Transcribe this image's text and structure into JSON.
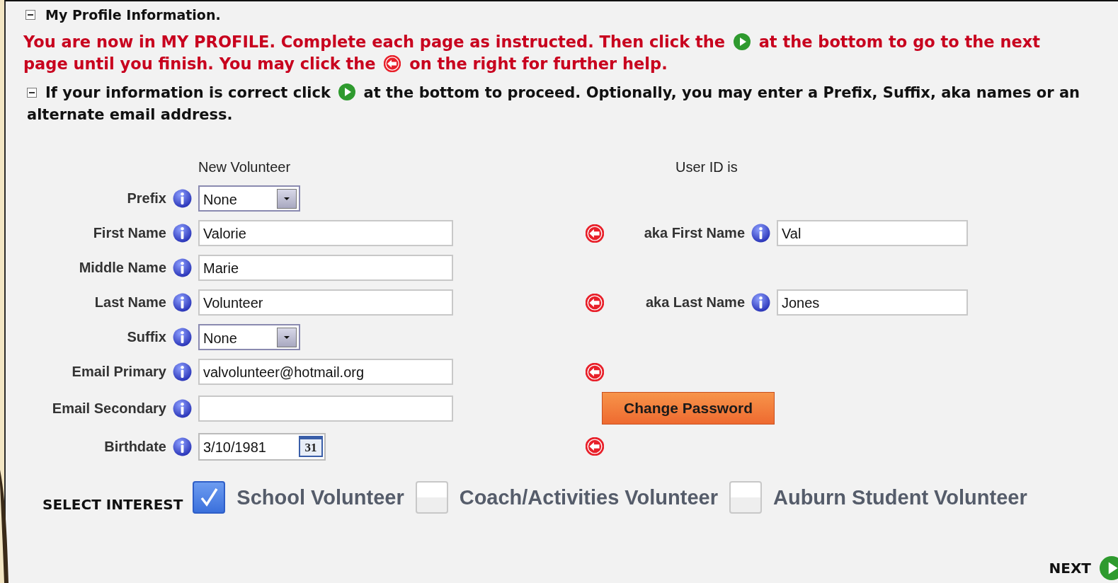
{
  "section": {
    "title": "My Profile Information.",
    "expanded": true
  },
  "instructions": [
    {
      "kind": "text",
      "text": "You are now in MY PROFILE. Complete each page as instructed. Then click the"
    },
    {
      "kind": "next_icon"
    },
    {
      "kind": "text",
      "text": "at the bottom to go to the next"
    },
    {
      "kind": "text",
      "text": "page until you finish. You may click the"
    },
    {
      "kind": "help_icon"
    },
    {
      "kind": "text",
      "text": "on the right for further help."
    }
  ],
  "subsection": {
    "expanded": true,
    "parts": [
      {
        "kind": "text",
        "text": "If your information is correct click"
      },
      {
        "kind": "next_icon"
      },
      {
        "kind": "text",
        "text": "at the bottom to proceed. Optionally, you may enter a Prefix, Suffix, aka names or an"
      },
      {
        "kind": "text",
        "text": "alternate email address."
      }
    ]
  },
  "form": {
    "left_heading": "New Volunteer",
    "right_heading": "User ID is",
    "calendar_label": "31",
    "rows": [
      {
        "label": "Prefix",
        "kind": "select",
        "value": "None"
      },
      {
        "label": "First Name",
        "kind": "text",
        "value": "Valorie",
        "right": {
          "kind": "aka",
          "label": "aka First Name",
          "value": "Val"
        }
      },
      {
        "label": "Middle Name",
        "kind": "text",
        "value": "Marie"
      },
      {
        "label": "Last Name",
        "kind": "text",
        "value": "Volunteer",
        "right": {
          "kind": "aka",
          "label": "aka Last Name",
          "value": "Jones"
        }
      },
      {
        "label": "Suffix",
        "kind": "select",
        "value": "None"
      },
      {
        "label": "Email Primary",
        "kind": "text",
        "value": "valvolunteer@hotmail.org",
        "right": {
          "kind": "help"
        }
      },
      {
        "label": "Email Secondary",
        "kind": "text",
        "right": {
          "kind": "button",
          "label": "Change Password"
        }
      },
      {
        "label": "Birthdate",
        "kind": "date",
        "value": "3/10/1981",
        "right": {
          "kind": "help"
        }
      }
    ]
  },
  "interests": {
    "label": "SELECT INTEREST",
    "options": [
      {
        "label": "School Volunteer",
        "checked": true
      },
      {
        "label": "Coach/Activities Volunteer",
        "checked": false
      },
      {
        "label": "Auburn Student Volunteer",
        "checked": false
      }
    ]
  },
  "next_label": "NEXT"
}
